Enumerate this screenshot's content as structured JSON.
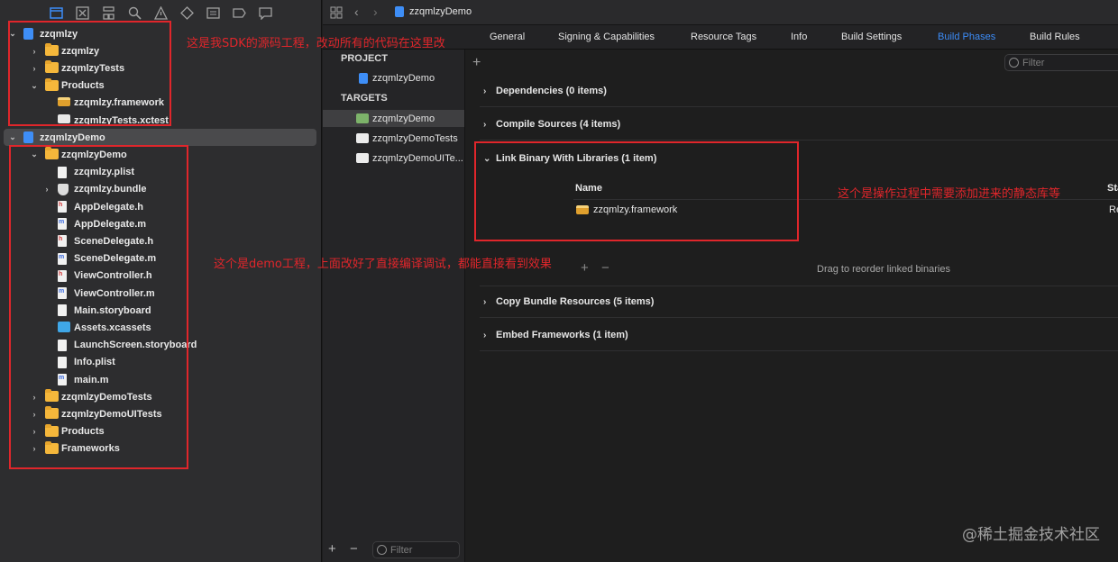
{
  "navigator": {
    "toolbar_icons": [
      "folder-icon",
      "source-control-icon",
      "hierarchy-icon",
      "search-icon",
      "warning-icon",
      "test-icon",
      "debug-icon",
      "breakpoint-icon",
      "report-icon"
    ],
    "tree": [
      {
        "label": "zzqmlzy",
        "type": "project",
        "disclosure": "open",
        "indent": 0
      },
      {
        "label": "zzqmlzy",
        "type": "folder",
        "disclosure": "closed",
        "indent": 1
      },
      {
        "label": "zzqmlzyTests",
        "type": "folder",
        "disclosure": "closed",
        "indent": 1
      },
      {
        "label": "Products",
        "type": "folder",
        "disclosure": "open",
        "indent": 1
      },
      {
        "label": "zzqmlzy.framework",
        "type": "framework",
        "disclosure": "",
        "indent": 2
      },
      {
        "label": "zzqmlzyTests.xctest",
        "type": "xctest",
        "disclosure": "",
        "indent": 2
      },
      {
        "label": "zzqmlzyDemo",
        "type": "project",
        "disclosure": "open",
        "indent": 0,
        "selected": true
      },
      {
        "label": "zzqmlzyDemo",
        "type": "folder",
        "disclosure": "open",
        "indent": 1
      },
      {
        "label": "zzqmlzy.plist",
        "type": "file",
        "disclosure": "",
        "indent": 2
      },
      {
        "label": "zzqmlzy.bundle",
        "type": "bundle",
        "disclosure": "closed",
        "indent": 2
      },
      {
        "label": "AppDelegate.h",
        "type": "h",
        "disclosure": "",
        "indent": 2
      },
      {
        "label": "AppDelegate.m",
        "type": "m",
        "disclosure": "",
        "indent": 2
      },
      {
        "label": "SceneDelegate.h",
        "type": "h",
        "disclosure": "",
        "indent": 2
      },
      {
        "label": "SceneDelegate.m",
        "type": "m",
        "disclosure": "",
        "indent": 2
      },
      {
        "label": "ViewController.h",
        "type": "h",
        "disclosure": "",
        "indent": 2
      },
      {
        "label": "ViewController.m",
        "type": "m",
        "disclosure": "",
        "indent": 2
      },
      {
        "label": "Main.storyboard",
        "type": "storyboard",
        "disclosure": "",
        "indent": 2
      },
      {
        "label": "Assets.xcassets",
        "type": "assets",
        "disclosure": "",
        "indent": 2
      },
      {
        "label": "LaunchScreen.storyboard",
        "type": "storyboard",
        "disclosure": "",
        "indent": 2
      },
      {
        "label": "Info.plist",
        "type": "file",
        "disclosure": "",
        "indent": 2
      },
      {
        "label": "main.m",
        "type": "m",
        "disclosure": "",
        "indent": 2
      },
      {
        "label": "zzqmlzyDemoTests",
        "type": "folder",
        "disclosure": "closed",
        "indent": 1
      },
      {
        "label": "zzqmlzyDemoUITests",
        "type": "folder",
        "disclosure": "closed",
        "indent": 1
      },
      {
        "label": "Products",
        "type": "folder",
        "disclosure": "closed",
        "indent": 1
      },
      {
        "label": "Frameworks",
        "type": "folder",
        "disclosure": "closed",
        "indent": 1
      }
    ]
  },
  "jumpbar": {
    "file": "zzqmlzyDemo"
  },
  "tabs": [
    {
      "label": "General"
    },
    {
      "label": "Signing & Capabilities"
    },
    {
      "label": "Resource Tags"
    },
    {
      "label": "Info"
    },
    {
      "label": "Build Settings"
    },
    {
      "label": "Build Phases",
      "active": true
    },
    {
      "label": "Build Rules"
    }
  ],
  "targets_panel": {
    "project_header": "PROJECT",
    "project_item": "zzqmlzyDemo",
    "targets_header": "TARGETS",
    "targets": [
      "zzqmlzyDemo",
      "zzqmlzyDemoTests",
      "zzqmlzyDemoUITe..."
    ],
    "filter_placeholder": "Filter"
  },
  "phases": {
    "filter_placeholder": "Filter",
    "items": [
      {
        "label": "Dependencies (0 items)",
        "open": false
      },
      {
        "label": "Compile Sources (4 items)",
        "open": false
      },
      {
        "label": "Link Binary With Libraries (1 item)",
        "open": true
      },
      {
        "label": "Copy Bundle Resources (5 items)",
        "open": false
      },
      {
        "label": "Embed Frameworks (1 item)",
        "open": false
      }
    ],
    "col_name": "Name",
    "col_status": "Sta",
    "library": "zzqmlzy.framework",
    "library_status": "Re",
    "drag_hint": "Drag to reorder linked binaries"
  },
  "annotations": {
    "note1": "这是我SDK的源码工程，改动所有的代码在这里改",
    "note2": "这个是操作过程中需要添加进来的静态库等",
    "note3": "这个是demo工程，上面改好了直接编译调试，都能直接看到效果"
  },
  "watermark": "@稀土掘金技术社区",
  "colors": {
    "accent": "#3c8cf7",
    "annotation": "#e0262b",
    "folder": "#f5b73b"
  }
}
